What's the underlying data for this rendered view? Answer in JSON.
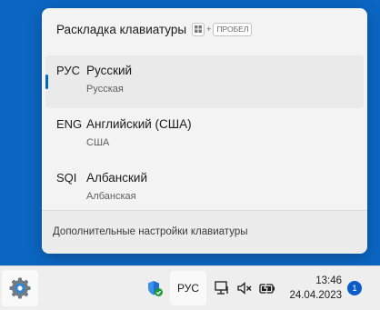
{
  "flyout": {
    "title": "Раскладка клавиатуры",
    "shortcut": {
      "plus": "+",
      "key": "ПРОБЕЛ"
    },
    "languages": [
      {
        "code": "РУС",
        "name": "Русский",
        "layout": "Русская",
        "selected": true
      },
      {
        "code": "ENG",
        "name": "Английский (США)",
        "layout": "США",
        "selected": false
      },
      {
        "code": "SQI",
        "name": "Албанский",
        "layout": "Албанская",
        "selected": false
      }
    ],
    "footer_link": "Дополнительные настройки клавиатуры"
  },
  "taskbar": {
    "language_indicator": "РУС",
    "clock": {
      "time": "13:46",
      "date": "24.04.2023"
    },
    "notification_count": "1",
    "icons": [
      "settings-gear-icon",
      "security-shield-icon",
      "network-icon",
      "volume-muted-icon",
      "battery-icon"
    ]
  },
  "colors": {
    "desktop_background": "#0b66c2",
    "accent": "#0067c0",
    "flyout_background": "#f3f3f3",
    "taskbar_background": "#eeeeee"
  }
}
